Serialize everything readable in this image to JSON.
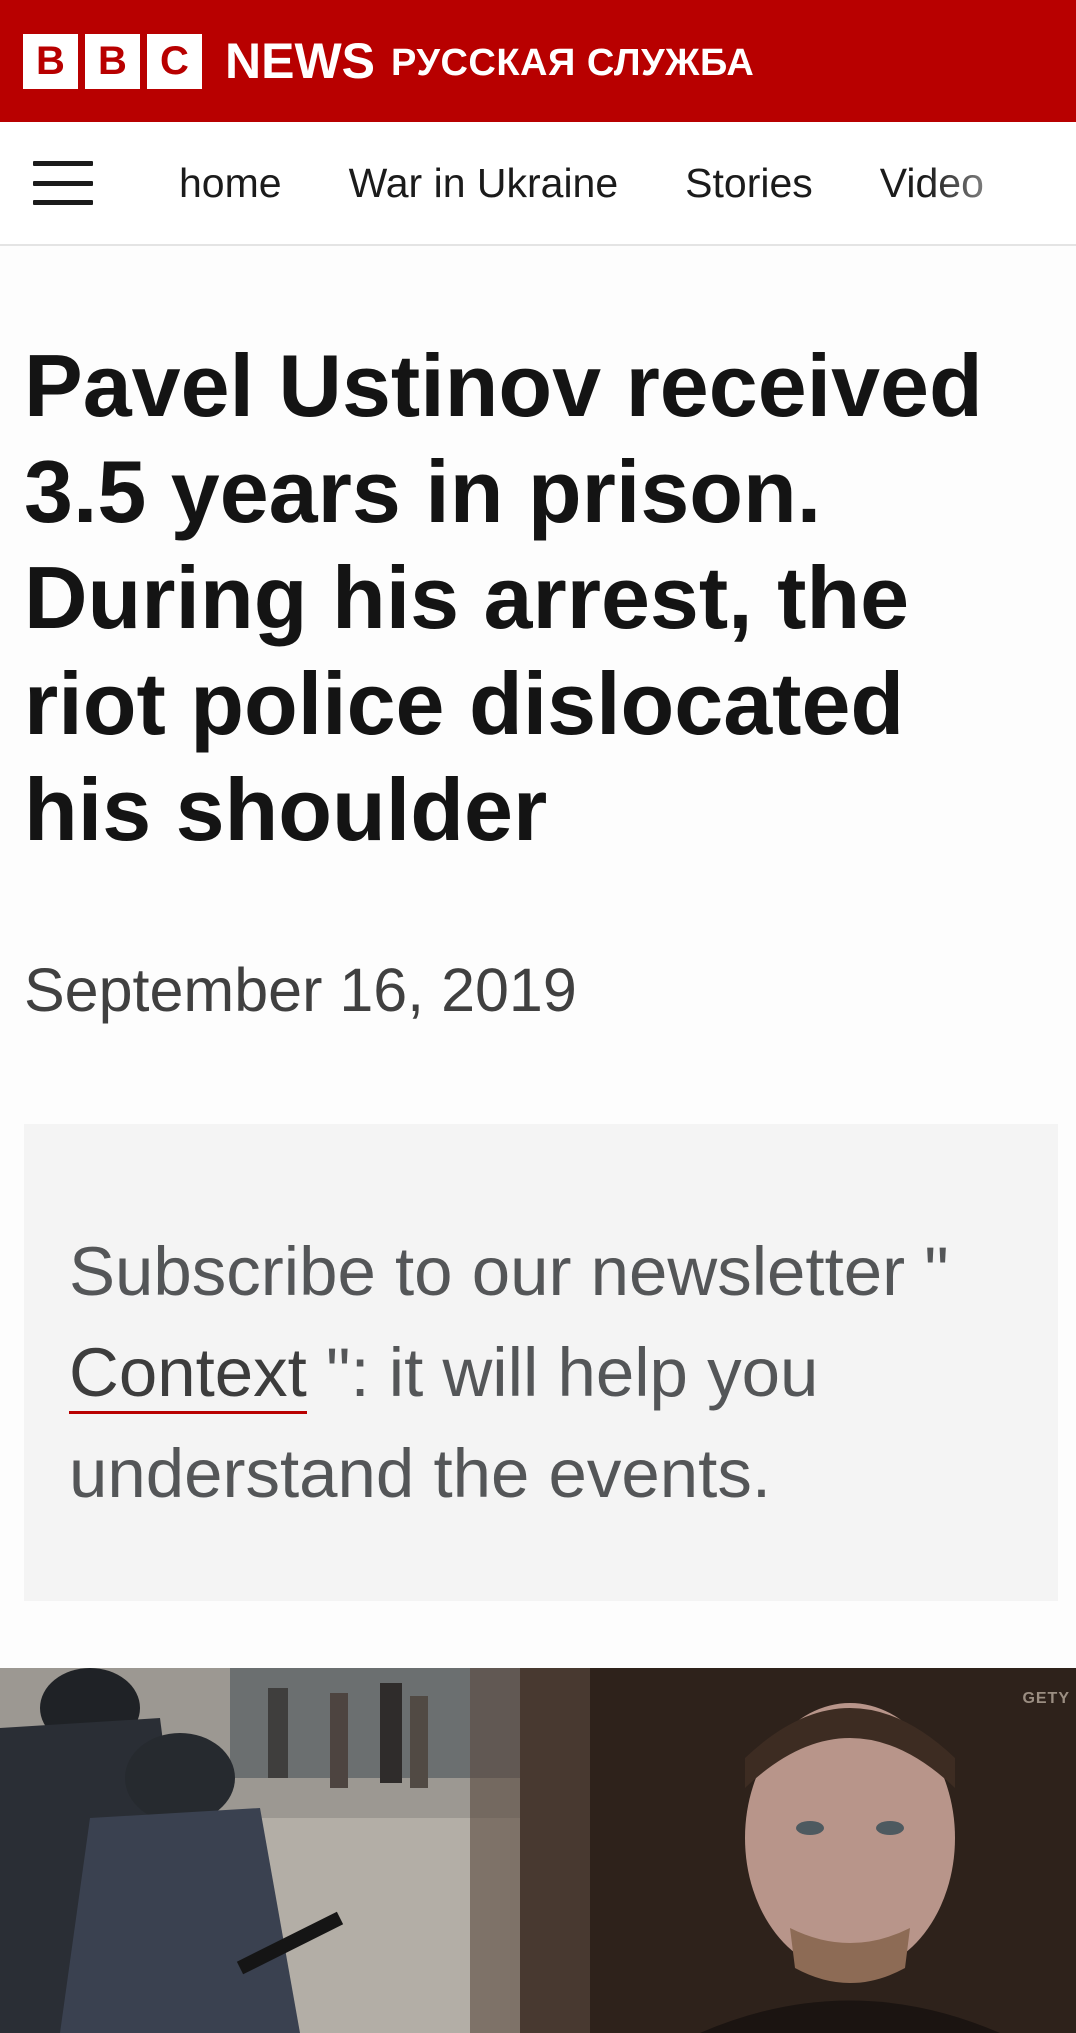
{
  "masthead": {
    "logo_letters": [
      "B",
      "B",
      "C"
    ],
    "news_word": "NEWS",
    "service_name": "РУССКАЯ СЛУЖБА",
    "brand_color": "#b80000"
  },
  "nav": {
    "menu_icon": "hamburger-menu-icon",
    "items": [
      {
        "label": "home"
      },
      {
        "label": "War in Ukraine"
      },
      {
        "label": "Stories"
      },
      {
        "label": "Video"
      }
    ]
  },
  "article": {
    "headline": "Pavel Ustinov received 3.5 years in prison. During his arrest, the riot police dislocated his shoulder",
    "date": "September 16, 2019"
  },
  "newsletter": {
    "text_before": "Subscribe to our newsletter \" ",
    "link_label": "Context",
    "text_after": " \": it will help you understand the events."
  },
  "hero_image": {
    "credit": "GETY"
  }
}
